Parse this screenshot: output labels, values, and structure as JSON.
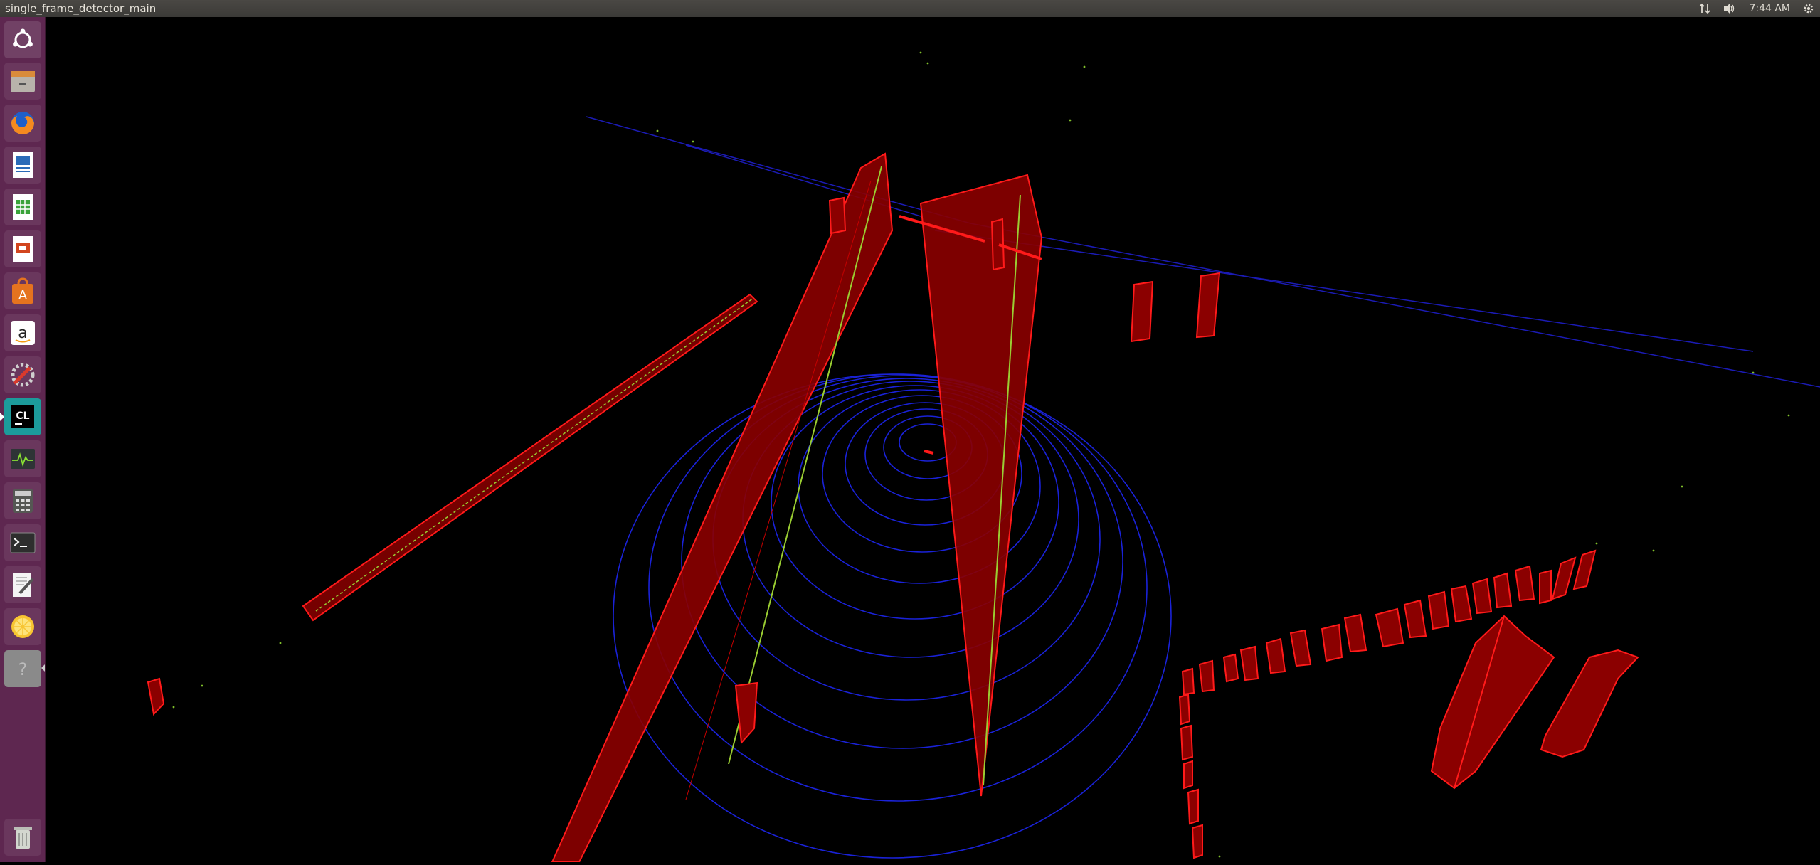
{
  "window": {
    "title": "single_frame_detector_main"
  },
  "tray": {
    "clock": "7:44 AM",
    "network_icon": "network-arrows-icon",
    "sound_icon": "speaker-icon",
    "settings_icon": "gear-icon"
  },
  "launcher": {
    "items": [
      {
        "name": "ubuntu-dash",
        "icon": "ubuntu-logo-icon"
      },
      {
        "name": "files",
        "icon": "file-cabinet-icon"
      },
      {
        "name": "firefox",
        "icon": "firefox-icon"
      },
      {
        "name": "writer",
        "icon": "document-icon"
      },
      {
        "name": "calc",
        "icon": "spreadsheet-icon"
      },
      {
        "name": "impress",
        "icon": "presentation-icon"
      },
      {
        "name": "software",
        "icon": "shopping-bag-icon"
      },
      {
        "name": "amazon",
        "icon": "amazon-icon"
      },
      {
        "name": "settings",
        "icon": "wrench-icon"
      },
      {
        "name": "clion",
        "icon": "clion-icon",
        "label": "CL"
      },
      {
        "name": "system-monitor",
        "icon": "heartbeat-icon"
      },
      {
        "name": "calculator",
        "icon": "calculator-icon"
      },
      {
        "name": "terminal",
        "icon": "terminal-icon",
        "label": ">_"
      },
      {
        "name": "text-editor",
        "icon": "pencil-icon"
      },
      {
        "name": "lemon",
        "icon": "lemon-icon"
      },
      {
        "name": "unknown-app",
        "icon": "question-icon",
        "label": "?"
      },
      {
        "name": "trash",
        "icon": "trash-icon"
      }
    ]
  },
  "scene": {
    "description_colors": {
      "bounding_box": "#ff1a1a",
      "box_fill": "#8b0000",
      "ground_points": "#1a1ae6",
      "object_points": "#9acd32"
    }
  }
}
